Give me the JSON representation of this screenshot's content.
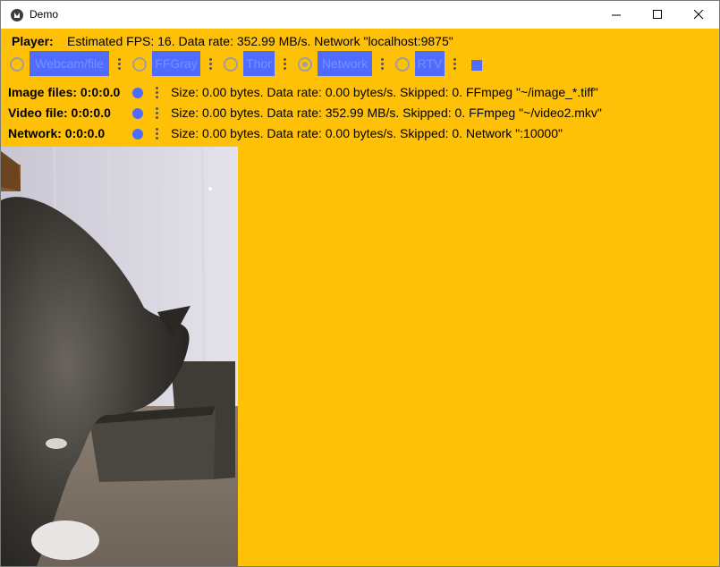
{
  "window": {
    "title": "Demo"
  },
  "player": {
    "label": "Player:",
    "status": "Estimated FPS: 16. Data rate: 352.99 MB/s. Network \"localhost:9875\"",
    "options": [
      {
        "label": "Webcam/file",
        "selected": false
      },
      {
        "label": "FFGray",
        "selected": false
      },
      {
        "label": "Thor",
        "selected": false
      },
      {
        "label": "Network",
        "selected": true
      },
      {
        "label": "RTV",
        "selected": false
      }
    ]
  },
  "recorders": [
    {
      "label": "Image files: 0:0:0.0",
      "info": "Size: 0.00 bytes. Data rate: 0.00 bytes/s. Skipped: 0. FFmpeg \"~/image_*.tiff\""
    },
    {
      "label": "Video file: 0:0:0.0",
      "info": "Size: 0.00 bytes. Data rate: 352.99 MB/s. Skipped: 0. FFmpeg \"~/video2.mkv\""
    },
    {
      "label": "Network: 0:0:0.0",
      "info": "Size: 0.00 bytes. Data rate: 0.00 bytes/s. Skipped: 0. Network \":10000\""
    }
  ],
  "colors": {
    "background": "#ffc107",
    "accent": "#4f6cff"
  }
}
